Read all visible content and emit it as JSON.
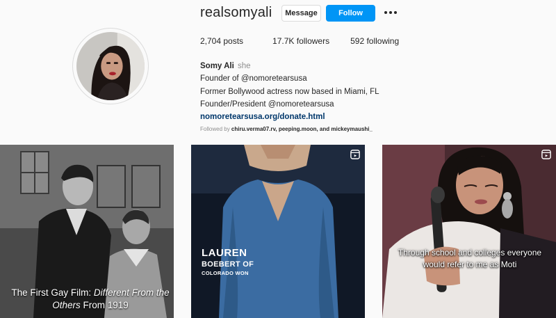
{
  "profile": {
    "username": "realsomyali",
    "message_label": "Message",
    "follow_label": "Follow",
    "posts": "2,704 posts",
    "followers": "17.7K followers",
    "following": "592 following",
    "name": "Somy Ali",
    "pronoun": "she",
    "bio_lines": [
      "Founder of @nomoretearsusa",
      "Former Bollywood actress now based in Miami, FL",
      "Founder/President @nomoretearsusa"
    ],
    "link": "nomoretearsusa.org/donate.html",
    "followed_prefix": "Followed by ",
    "followed_names": "chiru.verma07.rv, peeping.moon,",
    "followed_suffix": " and mickeymaushi_"
  },
  "posts": [
    {
      "caption_plain": "The First Gay Film: ",
      "caption_italic": "Different From the Others",
      "caption_end": " From 1919",
      "icon": "none"
    },
    {
      "caption_line1": "LAUREN",
      "caption_line2": "BOEBERT OF",
      "caption_line3": "COLORADO WON",
      "icon": "reel-icon"
    },
    {
      "caption": "Through school and colleges everyone would refer to me as Moti",
      "icon": "reel-icon"
    }
  ],
  "colors": {
    "follow_button": "#0095f6",
    "link": "#00376b",
    "muted": "#8e8e8e"
  }
}
